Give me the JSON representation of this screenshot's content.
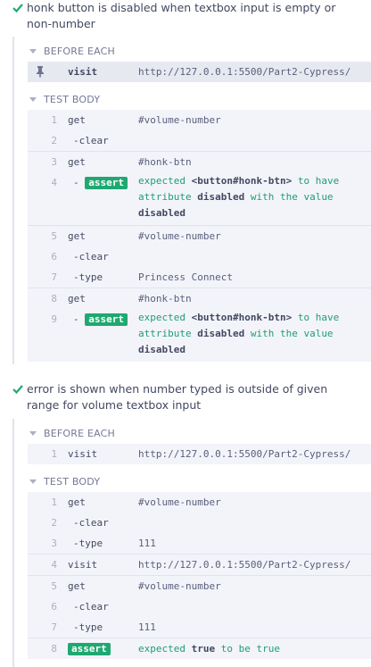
{
  "tests": [
    {
      "title": "honk button is disabled when textbox input is empty or non-number",
      "before_each_label": "BEFORE EACH",
      "before_each": [
        {
          "num": "",
          "name": "visit",
          "msg": "http://127.0.0.1:5500/Part2-Cypress/",
          "pinned": true
        }
      ],
      "test_body_label": "TEST BODY",
      "commands": [
        {
          "num": "1",
          "name": "get",
          "msg": "#volume-number"
        },
        {
          "num": "2",
          "name": "-clear",
          "msg": ""
        },
        {
          "num": "3",
          "name": "get",
          "msg": "#honk-btn"
        },
        {
          "num": "4",
          "name": "assert",
          "prefix": "-",
          "msg_parts": [
            "expected",
            "<button#honk-btn>",
            "to have attribute",
            "disabled",
            "with the value",
            "disabled"
          ]
        },
        {
          "num": "5",
          "name": "get",
          "msg": "#volume-number"
        },
        {
          "num": "6",
          "name": "-clear",
          "msg": ""
        },
        {
          "num": "7",
          "name": "-type",
          "msg": "Princess Connect"
        },
        {
          "num": "8",
          "name": "get",
          "msg": "#honk-btn"
        },
        {
          "num": "9",
          "name": "assert",
          "prefix": "-",
          "msg_parts": [
            "expected",
            "<button#honk-btn>",
            "to have attribute",
            "disabled",
            "with the value",
            "disabled"
          ]
        }
      ]
    },
    {
      "title": "error is shown when number typed is outside of given range for volume textbox input",
      "before_each_label": "BEFORE EACH",
      "before_each": [
        {
          "num": "1",
          "name": "visit",
          "msg": "http://127.0.0.1:5500/Part2-Cypress/"
        }
      ],
      "test_body_label": "TEST BODY",
      "commands": [
        {
          "num": "1",
          "name": "get",
          "msg": "#volume-number"
        },
        {
          "num": "2",
          "name": "-clear",
          "msg": ""
        },
        {
          "num": "3",
          "name": "-type",
          "msg": "111"
        },
        {
          "num": "4",
          "name": "visit",
          "msg": "http://127.0.0.1:5500/Part2-Cypress/"
        },
        {
          "num": "5",
          "name": "get",
          "msg": "#volume-number"
        },
        {
          "num": "6",
          "name": "-clear",
          "msg": ""
        },
        {
          "num": "7",
          "name": "-type",
          "msg": "111"
        },
        {
          "num": "8",
          "name": "assert",
          "msg_parts": [
            "expected",
            "true",
            "to be true"
          ]
        }
      ]
    }
  ],
  "colors": {
    "pass": "#1fa971",
    "keyword": "#1f9d72",
    "text": "#434861",
    "muted": "#aab0c2",
    "row_bg": "#f3f4fa"
  },
  "icons": {
    "pass": "check-icon",
    "pin": "pin-icon",
    "collapse": "caret-down-icon"
  }
}
